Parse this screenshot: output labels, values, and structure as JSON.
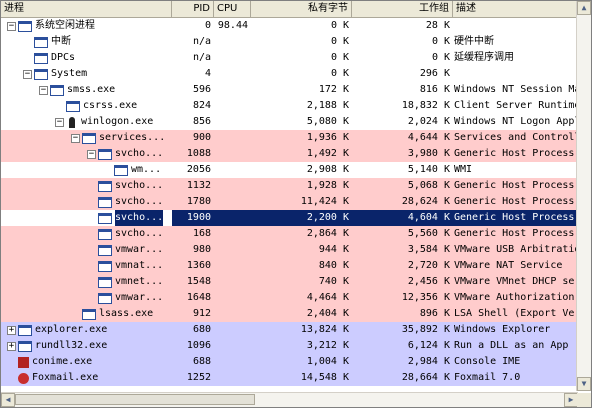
{
  "columns": {
    "process": "进程",
    "pid": "PID",
    "cpu": "CPU",
    "private_bytes": "私有字节",
    "working_set": "工作组",
    "description": "描述"
  },
  "rows": [
    {
      "name": "系统空闲进程",
      "pid": "0",
      "cpu": "98.44",
      "priv": "0 K",
      "ws": "28 K",
      "desc": "",
      "depth": 0,
      "expander": "−",
      "icon": "window",
      "bg": "none"
    },
    {
      "name": "中断",
      "pid": "n/a",
      "cpu": "",
      "priv": "0 K",
      "ws": "0 K",
      "desc": "硬件中断",
      "depth": 1,
      "expander": "",
      "icon": "window",
      "bg": "none"
    },
    {
      "name": "DPCs",
      "pid": "n/a",
      "cpu": "",
      "priv": "0 K",
      "ws": "0 K",
      "desc": "延缓程序调用",
      "depth": 1,
      "expander": "",
      "icon": "window",
      "bg": "none"
    },
    {
      "name": "System",
      "pid": "4",
      "cpu": "",
      "priv": "0 K",
      "ws": "296 K",
      "desc": "",
      "depth": 1,
      "expander": "−",
      "icon": "window",
      "bg": "none"
    },
    {
      "name": "smss.exe",
      "pid": "596",
      "cpu": "",
      "priv": "172 K",
      "ws": "816 K",
      "desc": "Windows NT Session Ma",
      "depth": 2,
      "expander": "−",
      "icon": "exe",
      "bg": "none"
    },
    {
      "name": "csrss.exe",
      "pid": "824",
      "cpu": "",
      "priv": "2,188 K",
      "ws": "18,832 K",
      "desc": "Client Server Runtime",
      "depth": 3,
      "expander": "",
      "icon": "exe",
      "bg": "none"
    },
    {
      "name": "winlogon.exe",
      "pid": "856",
      "cpu": "",
      "priv": "5,080 K",
      "ws": "2,024 K",
      "desc": "Windows NT Logon Appl",
      "depth": 3,
      "expander": "−",
      "icon": "winlogon",
      "bg": "none"
    },
    {
      "name": "services...",
      "pid": "900",
      "cpu": "",
      "priv": "1,936 K",
      "ws": "4,644 K",
      "desc": "Services and Controll",
      "depth": 4,
      "expander": "−",
      "icon": "exe",
      "bg": "pink"
    },
    {
      "name": "svcho...",
      "pid": "1088",
      "cpu": "",
      "priv": "1,492 K",
      "ws": "3,980 K",
      "desc": "Generic Host Process",
      "depth": 5,
      "expander": "−",
      "icon": "exe",
      "bg": "pink"
    },
    {
      "name": "wm...",
      "pid": "2056",
      "cpu": "",
      "priv": "2,908 K",
      "ws": "5,140 K",
      "desc": "WMI",
      "depth": 6,
      "expander": "",
      "icon": "exe",
      "bg": "none"
    },
    {
      "name": "svcho...",
      "pid": "1132",
      "cpu": "",
      "priv": "1,928 K",
      "ws": "5,068 K",
      "desc": "Generic Host Process",
      "depth": 5,
      "expander": "",
      "icon": "exe",
      "bg": "pink"
    },
    {
      "name": "svcho...",
      "pid": "1780",
      "cpu": "",
      "priv": "11,424 K",
      "ws": "28,624 K",
      "desc": "Generic Host Process",
      "depth": 5,
      "expander": "",
      "icon": "exe",
      "bg": "pink"
    },
    {
      "name": "svcho...",
      "pid": "1900",
      "cpu": "",
      "priv": "2,200 K",
      "ws": "4,604 K",
      "desc": "Generic Host Process",
      "depth": 5,
      "expander": "",
      "icon": "exe",
      "bg": "sel"
    },
    {
      "name": "svcho...",
      "pid": "168",
      "cpu": "",
      "priv": "2,864 K",
      "ws": "5,560 K",
      "desc": "Generic Host Process",
      "depth": 5,
      "expander": "",
      "icon": "exe",
      "bg": "pink"
    },
    {
      "name": "vmwar...",
      "pid": "980",
      "cpu": "",
      "priv": "944 K",
      "ws": "3,584 K",
      "desc": "VMware USB Arbitratio",
      "depth": 5,
      "expander": "",
      "icon": "exe",
      "bg": "pink"
    },
    {
      "name": "vmnat...",
      "pid": "1360",
      "cpu": "",
      "priv": "840 K",
      "ws": "2,720 K",
      "desc": "VMware NAT Service",
      "depth": 5,
      "expander": "",
      "icon": "exe",
      "bg": "pink"
    },
    {
      "name": "vmnet...",
      "pid": "1548",
      "cpu": "",
      "priv": "740 K",
      "ws": "2,456 K",
      "desc": "VMware VMnet DHCP ser",
      "depth": 5,
      "expander": "",
      "icon": "exe",
      "bg": "pink"
    },
    {
      "name": "vmwar...",
      "pid": "1648",
      "cpu": "",
      "priv": "4,464 K",
      "ws": "12,356 K",
      "desc": "VMware Authorization",
      "depth": 5,
      "expander": "",
      "icon": "exe",
      "bg": "pink"
    },
    {
      "name": "lsass.exe",
      "pid": "912",
      "cpu": "",
      "priv": "2,404 K",
      "ws": "896 K",
      "desc": "LSA Shell (Export Ver",
      "depth": 4,
      "expander": "",
      "icon": "exe",
      "bg": "pink"
    },
    {
      "name": "explorer.exe",
      "pid": "680",
      "cpu": "",
      "priv": "13,824 K",
      "ws": "35,892 K",
      "desc": "Windows Explorer",
      "depth": 0,
      "expander": "+",
      "icon": "window",
      "bg": "lav"
    },
    {
      "name": "rundll32.exe",
      "pid": "1096",
      "cpu": "",
      "priv": "3,212 K",
      "ws": "6,124 K",
      "desc": "Run a DLL as an App",
      "depth": 0,
      "expander": "+",
      "icon": "window",
      "bg": "lav"
    },
    {
      "name": "conime.exe",
      "pid": "688",
      "cpu": "",
      "priv": "1,004 K",
      "ws": "2,984 K",
      "desc": "Console IME",
      "depth": 0,
      "expander": "",
      "icon": "conime",
      "bg": "lav"
    },
    {
      "name": "Foxmail.exe",
      "pid": "1252",
      "cpu": "",
      "priv": "14,548 K",
      "ws": "28,664 K",
      "desc": "Foxmail 7.0",
      "depth": 0,
      "expander": "",
      "icon": "red",
      "bg": "lav"
    }
  ],
  "colors": {
    "pink": "#ffcccc",
    "lavender": "#ccccff",
    "selected": "#0a246a"
  }
}
